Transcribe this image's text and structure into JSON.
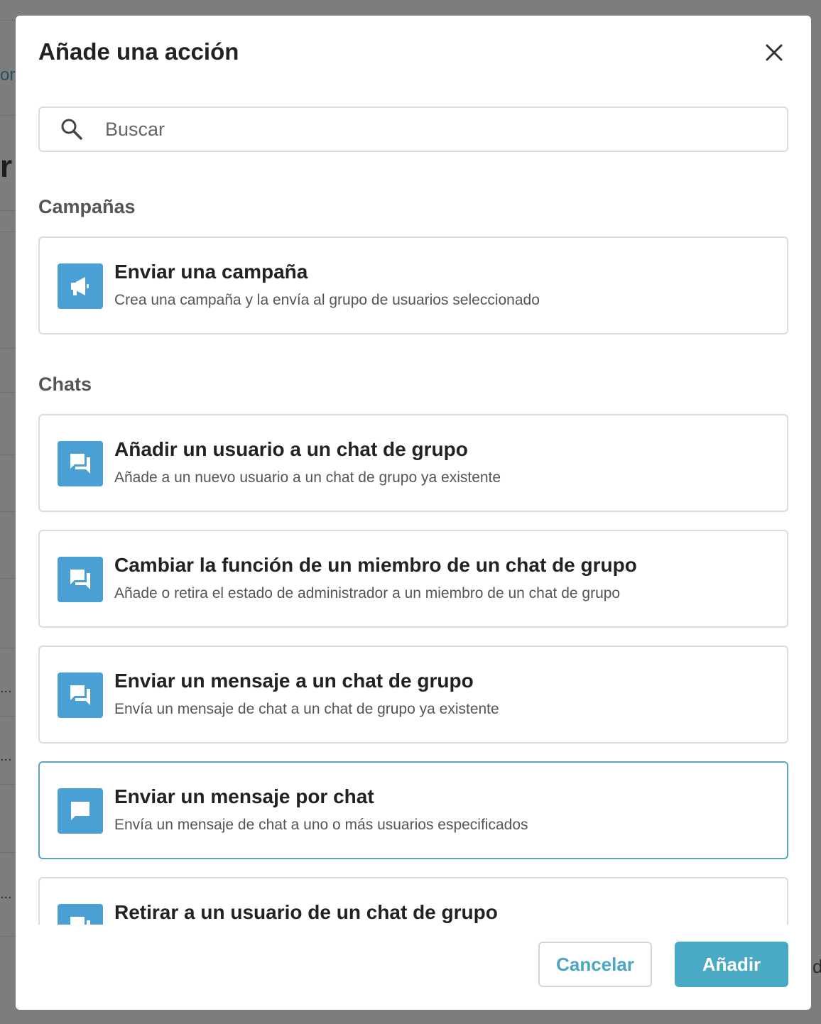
{
  "modal": {
    "title": "Añade una acción",
    "close_icon": "close-icon"
  },
  "search": {
    "placeholder": "Buscar",
    "value": ""
  },
  "sections": {
    "campaigns": {
      "title": "Campañas",
      "items": [
        {
          "title": "Enviar una campaña",
          "description": "Crea una campaña y la envía al grupo de usuarios seleccionado",
          "icon": "megaphone-icon"
        }
      ]
    },
    "chats": {
      "title": "Chats",
      "items": [
        {
          "title": "Añadir un usuario a un chat de grupo",
          "description": "Añade a un nuevo usuario a un chat de grupo ya existente",
          "icon": "group-chat-icon"
        },
        {
          "title": "Cambiar la función de un miembro de un chat de grupo",
          "description": "Añade o retira el estado de administrador a un miembro de un chat de grupo",
          "icon": "group-chat-icon"
        },
        {
          "title": "Enviar un mensaje a un chat de grupo",
          "description": "Envía un mensaje de chat a un chat de grupo ya existente",
          "icon": "group-chat-icon"
        },
        {
          "title": "Enviar un mensaje por chat",
          "description": "Envía un mensaje de chat a uno o más usuarios especificados",
          "icon": "chat-bubble-icon",
          "selected": true
        },
        {
          "title": "Retirar a un usuario de un chat de grupo",
          "description": "",
          "icon": "group-chat-icon"
        }
      ]
    }
  },
  "footer": {
    "cancel_label": "Cancelar",
    "add_label": "Añadir"
  },
  "background": {
    "fragments": [
      "or",
      "r",
      "...",
      "...",
      "...",
      "d"
    ]
  },
  "colors": {
    "icon_bg": "#4a9fd4",
    "accent": "#4aa9c4",
    "selected_border": "#5aa5bf",
    "overlay": "#7d7d7d"
  }
}
